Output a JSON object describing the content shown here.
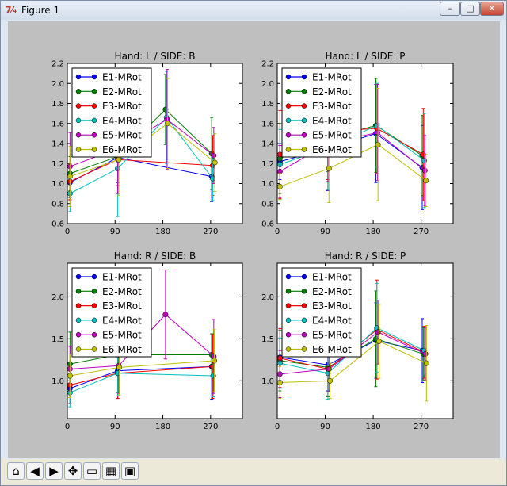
{
  "window": {
    "title": "Figure 1",
    "app_icon": "matplotlib-icon",
    "min_label": "–",
    "max_label": "□",
    "close_label": "✕"
  },
  "toolbar": {
    "buttons": [
      {
        "icon": "home-icon",
        "glyph": "⌂"
      },
      {
        "icon": "back-icon",
        "glyph": "◀"
      },
      {
        "icon": "forward-icon",
        "glyph": "▶"
      },
      {
        "icon": "pan-icon",
        "glyph": "✥"
      },
      {
        "icon": "zoom-icon",
        "glyph": "▭"
      },
      {
        "icon": "configure-icon",
        "glyph": "▦"
      },
      {
        "icon": "save-icon",
        "glyph": "▣"
      }
    ]
  },
  "colors": {
    "E1-MRot": "#0000ff",
    "E2-MRot": "#007f00",
    "E3-MRot": "#ff0000",
    "E4-MRot": "#00bfbf",
    "E5-MRot": "#bf00bf",
    "E6-MRot": "#bfbf00"
  },
  "chart_data": [
    {
      "type": "line",
      "title": "Hand: L / SIDE: B",
      "xlim": [
        0,
        330
      ],
      "ylim": [
        0.6,
        2.2
      ],
      "xticks": [
        0,
        90,
        180,
        270
      ],
      "yticks": [
        0.6,
        0.8,
        1.0,
        1.2,
        1.4,
        1.6,
        1.8,
        2.0,
        2.2
      ],
      "legend": "upper-left",
      "series": [
        {
          "name": "E1-MRot",
          "points": [
            [
              5,
              1.01,
              0.15
            ],
            [
              95,
              1.26,
              0.25
            ],
            [
              272,
              1.07,
              0.25
            ]
          ]
        },
        {
          "name": "E2-MRot",
          "points": [
            [
              5,
              1.1,
              0.17
            ],
            [
              95,
              1.27,
              0.37
            ],
            [
              185,
              1.74,
              0.35
            ],
            [
              272,
              1.3,
              0.36
            ]
          ]
        },
        {
          "name": "E3-MRot",
          "points": [
            [
              5,
              1.02,
              0.18
            ],
            [
              95,
              1.24,
              0.26
            ],
            [
              274,
              1.18,
              0.3
            ]
          ]
        },
        {
          "name": "E4-MRot",
          "points": [
            [
              5,
              0.9,
              0.18
            ],
            [
              95,
              1.15,
              0.48
            ],
            [
              187,
              1.66,
              0.46
            ],
            [
              274,
              1.05,
              0.22
            ]
          ]
        },
        {
          "name": "E5-MRot",
          "points": [
            [
              5,
              1.17,
              0.34
            ],
            [
              95,
              1.35,
              0.45
            ],
            [
              188,
              1.64,
              0.5
            ],
            [
              276,
              1.28,
              0.28
            ]
          ]
        },
        {
          "name": "E6-MRot",
          "points": [
            [
              5,
              1.07,
              0.3
            ],
            [
              97,
              1.24,
              0.36
            ],
            [
              189,
              1.6,
              0.45
            ],
            [
              278,
              1.21,
              0.29
            ]
          ]
        }
      ]
    },
    {
      "type": "line",
      "title": "Hand: L / SIDE: P",
      "xlim": [
        0,
        330
      ],
      "ylim": [
        0.6,
        2.2
      ],
      "xticks": [
        0,
        90,
        180,
        270
      ],
      "yticks": [
        0.6,
        0.8,
        1.0,
        1.2,
        1.4,
        1.6,
        1.8,
        2.0,
        2.2
      ],
      "legend": "upper-left",
      "series": [
        {
          "name": "E1-MRot",
          "points": [
            [
              5,
              1.22,
              0.18
            ],
            [
              95,
              1.35,
              0.42
            ],
            [
              185,
              1.5,
              0.49
            ],
            [
              272,
              1.16,
              0.42
            ]
          ]
        },
        {
          "name": "E2-MRot",
          "points": [
            [
              5,
              1.25,
              0.35
            ],
            [
              95,
              1.45,
              0.33
            ],
            [
              185,
              1.58,
              0.47
            ],
            [
              272,
              1.28,
              0.4
            ]
          ]
        },
        {
          "name": "E3-MRot",
          "points": [
            [
              5,
              1.29,
              0.44
            ],
            [
              95,
              1.52,
              0.48
            ],
            [
              187,
              1.55,
              0.45
            ],
            [
              274,
              1.29,
              0.46
            ]
          ]
        },
        {
          "name": "E4-MRot",
          "points": [
            [
              5,
              1.19,
              0.35
            ],
            [
              95,
              1.36,
              0.42
            ],
            [
              187,
              1.58,
              0.42
            ],
            [
              276,
              1.23,
              0.47
            ]
          ]
        },
        {
          "name": "E5-MRot",
          "points": [
            [
              5,
              1.12,
              0.26
            ],
            [
              95,
              1.4,
              0.38
            ],
            [
              188,
              1.51,
              0.48
            ],
            [
              277,
              1.13,
              0.35
            ]
          ]
        },
        {
          "name": "E6-MRot",
          "points": [
            [
              5,
              0.97,
              0.13
            ],
            [
              97,
              1.15,
              0.34
            ],
            [
              189,
              1.39,
              0.56
            ],
            [
              279,
              1.03,
              0.26
            ]
          ]
        }
      ]
    },
    {
      "type": "line",
      "title": "Hand: R / SIDE: B",
      "xlim": [
        0,
        330
      ],
      "ylim": [
        0.55,
        2.4
      ],
      "xticks": [
        0,
        90,
        180,
        270
      ],
      "yticks": [
        1.0,
        1.5,
        2.0
      ],
      "legend": "upper-left",
      "series": [
        {
          "name": "E1-MRot",
          "points": [
            [
              5,
              0.91,
              0.18
            ],
            [
              95,
              1.12,
              0.33
            ],
            [
              272,
              1.17,
              0.39
            ]
          ]
        },
        {
          "name": "E2-MRot",
          "points": [
            [
              5,
              1.2,
              0.38
            ],
            [
              95,
              1.31,
              0.45
            ],
            [
              272,
              1.31,
              0.25
            ]
          ]
        },
        {
          "name": "E3-MRot",
          "points": [
            [
              5,
              0.95,
              0.22
            ],
            [
              95,
              1.09,
              0.3
            ],
            [
              274,
              1.17,
              0.38
            ]
          ]
        },
        {
          "name": "E4-MRot",
          "points": [
            [
              5,
              0.86,
              0.17
            ],
            [
              95,
              1.09,
              0.27
            ],
            [
              275,
              1.06,
              0.25
            ]
          ]
        },
        {
          "name": "E5-MRot",
          "points": [
            [
              5,
              1.14,
              0.27
            ],
            [
              97,
              1.18,
              0.33
            ],
            [
              185,
              1.79,
              0.53
            ],
            [
              276,
              1.29,
              0.44
            ]
          ]
        },
        {
          "name": "E6-MRot",
          "points": [
            [
              5,
              1.06,
              0.26
            ],
            [
              98,
              1.16,
              0.33
            ],
            [
              277,
              1.24,
              0.37
            ]
          ]
        }
      ]
    },
    {
      "type": "line",
      "title": "Hand: R / SIDE: P",
      "xlim": [
        0,
        330
      ],
      "ylim": [
        0.55,
        2.4
      ],
      "xticks": [
        0,
        90,
        180,
        270
      ],
      "yticks": [
        1.0,
        1.5,
        2.0
      ],
      "legend": "upper-left",
      "series": [
        {
          "name": "E1-MRot",
          "points": [
            [
              5,
              1.28,
              0.36
            ],
            [
              95,
              1.19,
              0.31
            ],
            [
              185,
              1.48,
              0.45
            ],
            [
              272,
              1.36,
              0.38
            ]
          ]
        },
        {
          "name": "E2-MRot",
          "points": [
            [
              5,
              1.24,
              0.36
            ],
            [
              95,
              1.16,
              0.35
            ],
            [
              185,
              1.5,
              0.57
            ],
            [
              274,
              1.32,
              0.31
            ]
          ]
        },
        {
          "name": "E3-MRot",
          "points": [
            [
              5,
              1.27,
              0.35
            ],
            [
              95,
              1.14,
              0.32
            ],
            [
              187,
              1.61,
              0.59
            ],
            [
              276,
              1.34,
              0.31
            ]
          ]
        },
        {
          "name": "E4-MRot",
          "points": [
            [
              5,
              1.21,
              0.3
            ],
            [
              95,
              1.09,
              0.31
            ],
            [
              187,
              1.63,
              0.53
            ],
            [
              276,
              1.36,
              0.28
            ]
          ]
        },
        {
          "name": "E5-MRot",
          "points": [
            [
              5,
              1.08,
              0.28
            ],
            [
              97,
              1.14,
              0.27
            ],
            [
              189,
              1.58,
              0.38
            ],
            [
              278,
              1.32,
              0.31
            ]
          ]
        },
        {
          "name": "E6-MRot",
          "points": [
            [
              5,
              0.98,
              0.19
            ],
            [
              99,
              1.0,
              0.21
            ],
            [
              191,
              1.47,
              0.44
            ],
            [
              280,
              1.21,
              0.45
            ]
          ]
        }
      ]
    }
  ]
}
